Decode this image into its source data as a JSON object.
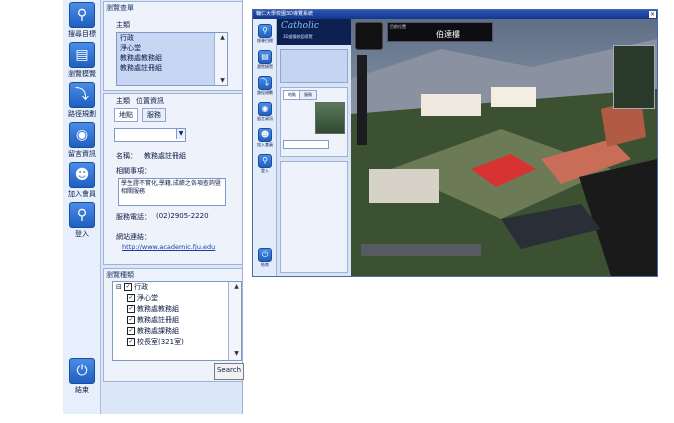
{
  "left_panel": {
    "nav": [
      {
        "label": "搜尋目標",
        "icon": "magnifier"
      },
      {
        "label": "瀏覽模覽",
        "icon": "layers"
      },
      {
        "label": "路徑規劃",
        "icon": "route"
      },
      {
        "label": "留言資訊",
        "icon": "speech-bubble"
      },
      {
        "label": "加入會員",
        "icon": "person"
      },
      {
        "label": "登入",
        "icon": "key"
      },
      {
        "label": "結束",
        "icon": "power"
      }
    ],
    "search_section": {
      "title": "瀏覽查單",
      "sub": "主類",
      "items": [
        "行政",
        "淨心堂",
        "教務處教務組",
        "教務處註冊組"
      ],
      "sub2": "主類",
      "sub2_name": "位置資訊"
    },
    "tabs": [
      "地點",
      "服務"
    ],
    "detail": {
      "name_label": "名稱：",
      "name_value": "教務處註冊組",
      "desc_label": "相關事項：",
      "desc_value": "學生證不實化,學籍,成績之各項查詢暨相關服務",
      "phone_label": "服務電話：",
      "phone_value": "(02)2905-2220",
      "url_label": "網站連結：",
      "url_value": "http://www.academic.fju.edu"
    },
    "tree_section": {
      "title": "瀏覽種類",
      "root": "行政",
      "items": [
        "淨心堂",
        "教務處教務組",
        "教務處註冊組",
        "教務處課務組",
        "校長室(321室)"
      ]
    },
    "search_button": "Search"
  },
  "app_window": {
    "title": "輔仁大學校園3D導覽系統",
    "brand": "Catholic",
    "brand_sub": "3D虛擬校園導覽",
    "building_label": "伯達樓",
    "location_label": "目前位置"
  }
}
